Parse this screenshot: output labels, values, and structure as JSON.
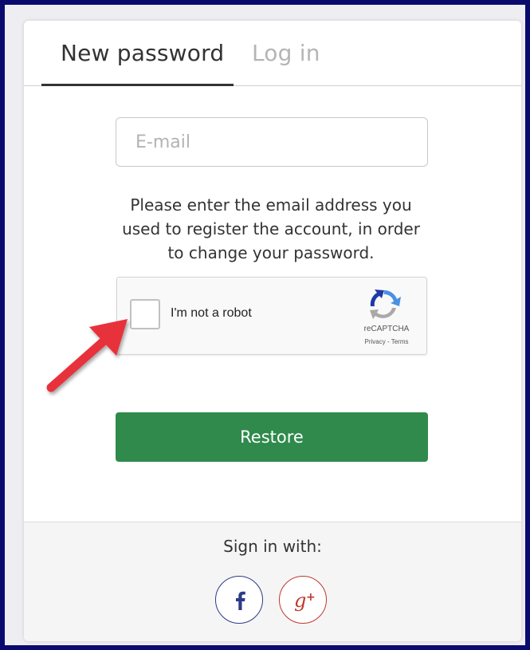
{
  "tabs": [
    {
      "label": "New password",
      "active": true
    },
    {
      "label": "Log in",
      "active": false
    }
  ],
  "email": {
    "placeholder": "E-mail",
    "value": ""
  },
  "help_text": "Please enter the email address you used to register the account, in order to change your password.",
  "captcha": {
    "label": "I'm not a robot",
    "brand": "reCAPTCHA",
    "links": "Privacy - Terms",
    "checked": false
  },
  "restore_label": "Restore",
  "footer": {
    "signin_label": "Sign in with:",
    "providers": [
      {
        "name": "facebook",
        "icon": "facebook-icon",
        "color": "#2e3a87"
      },
      {
        "name": "google-plus",
        "icon": "google-plus-icon",
        "color": "#c0392b"
      }
    ]
  },
  "colors": {
    "accent_green": "#2f8a4c",
    "annotation_arrow": "#e8303a",
    "frame": "#0a0a6e"
  }
}
